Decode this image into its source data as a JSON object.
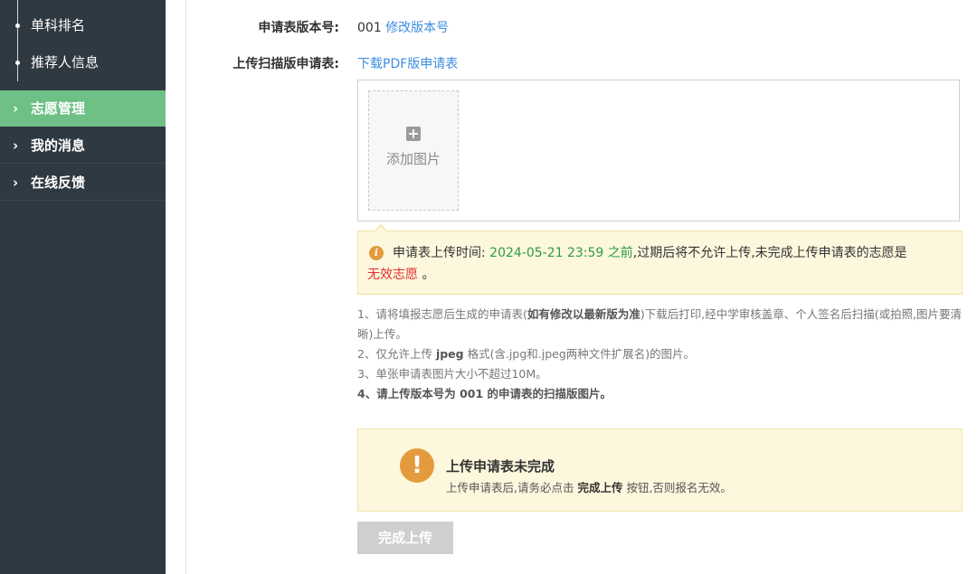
{
  "sidebar": {
    "sub_items": [
      {
        "label": "单科排名"
      },
      {
        "label": "推荐人信息"
      }
    ],
    "nav_items": [
      {
        "label": "志愿管理",
        "chevron": "›",
        "active": true
      },
      {
        "label": "我的消息",
        "chevron": "›",
        "active": false
      },
      {
        "label": "在线反馈",
        "chevron": "›",
        "active": false
      }
    ]
  },
  "form": {
    "version_label": "申请表版本号:",
    "version_value": "001",
    "modify_version_link": "修改版本号",
    "upload_label": "上传扫描版申请表:",
    "download_pdf_link": "下载PDF版申请表",
    "add_image_label": "添加图片",
    "add_image_icon": "plus-square-icon"
  },
  "notice": {
    "icon": "info-icon",
    "prefix": "申请表上传时间:",
    "deadline": "2024-05-21 23:59 之前",
    "middle": ",过期后将不允许上传,未完成上传申请表的志愿是",
    "invalid_text": "无效志愿",
    "suffix": "。"
  },
  "instructions": {
    "l1_a": "1、请将填报志愿后生成的申请表(",
    "l1_b": "如有修改以最新版为准",
    "l1_c": ")下载后打印,经中学审核盖章、个人签名后扫描(或拍照,图片要清晰)上传。",
    "l2_a": "2、仅允许上传 ",
    "l2_b": "jpeg",
    "l2_c": " 格式(含.jpg和.jpeg两种文件扩展名)的图片。",
    "l3": "3、单张申请表图片大小不超过10M。",
    "l4_a": "4、请上传版本号为 ",
    "l4_b": "001",
    "l4_c": " 的申请表的扫描版图片。"
  },
  "warning": {
    "icon": "exclamation-icon",
    "icon_glyph": "!",
    "title": "上传申请表未完成",
    "desc_a": "上传申请表后,请务必点击 ",
    "desc_b": "完成上传",
    "desc_c": " 按钮,否则报名无效。"
  },
  "buttons": {
    "complete_upload": "完成上传"
  },
  "colors": {
    "sidebar_bg": "#2f3941",
    "active_nav": "#6ec086",
    "link": "#3d8de0",
    "deadline_green": "#2e9b43",
    "invalid_red": "#e02f2f",
    "notice_bg": "#fdf7dd",
    "warn_icon": "#e39b3d"
  }
}
